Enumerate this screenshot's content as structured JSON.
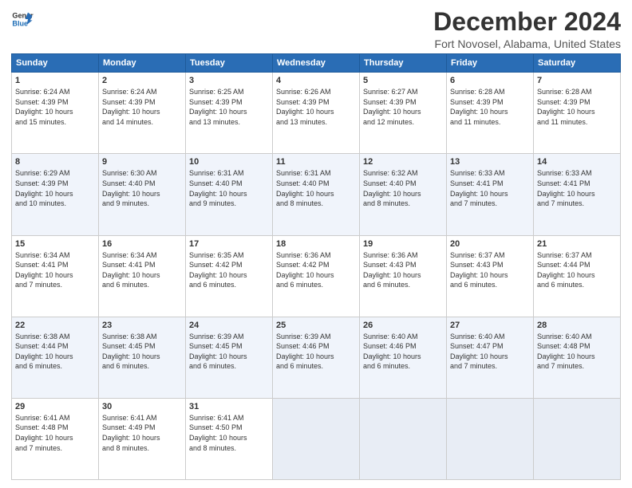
{
  "logo": {
    "line1": "General",
    "line2": "Blue"
  },
  "title": "December 2024",
  "subtitle": "Fort Novosel, Alabama, United States",
  "days_of_week": [
    "Sunday",
    "Monday",
    "Tuesday",
    "Wednesday",
    "Thursday",
    "Friday",
    "Saturday"
  ],
  "weeks": [
    [
      {
        "day": "1",
        "info": "Sunrise: 6:24 AM\nSunset: 4:39 PM\nDaylight: 10 hours\nand 15 minutes."
      },
      {
        "day": "2",
        "info": "Sunrise: 6:24 AM\nSunset: 4:39 PM\nDaylight: 10 hours\nand 14 minutes."
      },
      {
        "day": "3",
        "info": "Sunrise: 6:25 AM\nSunset: 4:39 PM\nDaylight: 10 hours\nand 13 minutes."
      },
      {
        "day": "4",
        "info": "Sunrise: 6:26 AM\nSunset: 4:39 PM\nDaylight: 10 hours\nand 13 minutes."
      },
      {
        "day": "5",
        "info": "Sunrise: 6:27 AM\nSunset: 4:39 PM\nDaylight: 10 hours\nand 12 minutes."
      },
      {
        "day": "6",
        "info": "Sunrise: 6:28 AM\nSunset: 4:39 PM\nDaylight: 10 hours\nand 11 minutes."
      },
      {
        "day": "7",
        "info": "Sunrise: 6:28 AM\nSunset: 4:39 PM\nDaylight: 10 hours\nand 11 minutes."
      }
    ],
    [
      {
        "day": "8",
        "info": "Sunrise: 6:29 AM\nSunset: 4:39 PM\nDaylight: 10 hours\nand 10 minutes."
      },
      {
        "day": "9",
        "info": "Sunrise: 6:30 AM\nSunset: 4:40 PM\nDaylight: 10 hours\nand 9 minutes."
      },
      {
        "day": "10",
        "info": "Sunrise: 6:31 AM\nSunset: 4:40 PM\nDaylight: 10 hours\nand 9 minutes."
      },
      {
        "day": "11",
        "info": "Sunrise: 6:31 AM\nSunset: 4:40 PM\nDaylight: 10 hours\nand 8 minutes."
      },
      {
        "day": "12",
        "info": "Sunrise: 6:32 AM\nSunset: 4:40 PM\nDaylight: 10 hours\nand 8 minutes."
      },
      {
        "day": "13",
        "info": "Sunrise: 6:33 AM\nSunset: 4:41 PM\nDaylight: 10 hours\nand 7 minutes."
      },
      {
        "day": "14",
        "info": "Sunrise: 6:33 AM\nSunset: 4:41 PM\nDaylight: 10 hours\nand 7 minutes."
      }
    ],
    [
      {
        "day": "15",
        "info": "Sunrise: 6:34 AM\nSunset: 4:41 PM\nDaylight: 10 hours\nand 7 minutes."
      },
      {
        "day": "16",
        "info": "Sunrise: 6:34 AM\nSunset: 4:41 PM\nDaylight: 10 hours\nand 6 minutes."
      },
      {
        "day": "17",
        "info": "Sunrise: 6:35 AM\nSunset: 4:42 PM\nDaylight: 10 hours\nand 6 minutes."
      },
      {
        "day": "18",
        "info": "Sunrise: 6:36 AM\nSunset: 4:42 PM\nDaylight: 10 hours\nand 6 minutes."
      },
      {
        "day": "19",
        "info": "Sunrise: 6:36 AM\nSunset: 4:43 PM\nDaylight: 10 hours\nand 6 minutes."
      },
      {
        "day": "20",
        "info": "Sunrise: 6:37 AM\nSunset: 4:43 PM\nDaylight: 10 hours\nand 6 minutes."
      },
      {
        "day": "21",
        "info": "Sunrise: 6:37 AM\nSunset: 4:44 PM\nDaylight: 10 hours\nand 6 minutes."
      }
    ],
    [
      {
        "day": "22",
        "info": "Sunrise: 6:38 AM\nSunset: 4:44 PM\nDaylight: 10 hours\nand 6 minutes."
      },
      {
        "day": "23",
        "info": "Sunrise: 6:38 AM\nSunset: 4:45 PM\nDaylight: 10 hours\nand 6 minutes."
      },
      {
        "day": "24",
        "info": "Sunrise: 6:39 AM\nSunset: 4:45 PM\nDaylight: 10 hours\nand 6 minutes."
      },
      {
        "day": "25",
        "info": "Sunrise: 6:39 AM\nSunset: 4:46 PM\nDaylight: 10 hours\nand 6 minutes."
      },
      {
        "day": "26",
        "info": "Sunrise: 6:40 AM\nSunset: 4:46 PM\nDaylight: 10 hours\nand 6 minutes."
      },
      {
        "day": "27",
        "info": "Sunrise: 6:40 AM\nSunset: 4:47 PM\nDaylight: 10 hours\nand 7 minutes."
      },
      {
        "day": "28",
        "info": "Sunrise: 6:40 AM\nSunset: 4:48 PM\nDaylight: 10 hours\nand 7 minutes."
      }
    ],
    [
      {
        "day": "29",
        "info": "Sunrise: 6:41 AM\nSunset: 4:48 PM\nDaylight: 10 hours\nand 7 minutes."
      },
      {
        "day": "30",
        "info": "Sunrise: 6:41 AM\nSunset: 4:49 PM\nDaylight: 10 hours\nand 8 minutes."
      },
      {
        "day": "31",
        "info": "Sunrise: 6:41 AM\nSunset: 4:50 PM\nDaylight: 10 hours\nand 8 minutes."
      },
      {
        "day": "",
        "info": ""
      },
      {
        "day": "",
        "info": ""
      },
      {
        "day": "",
        "info": ""
      },
      {
        "day": "",
        "info": ""
      }
    ]
  ]
}
